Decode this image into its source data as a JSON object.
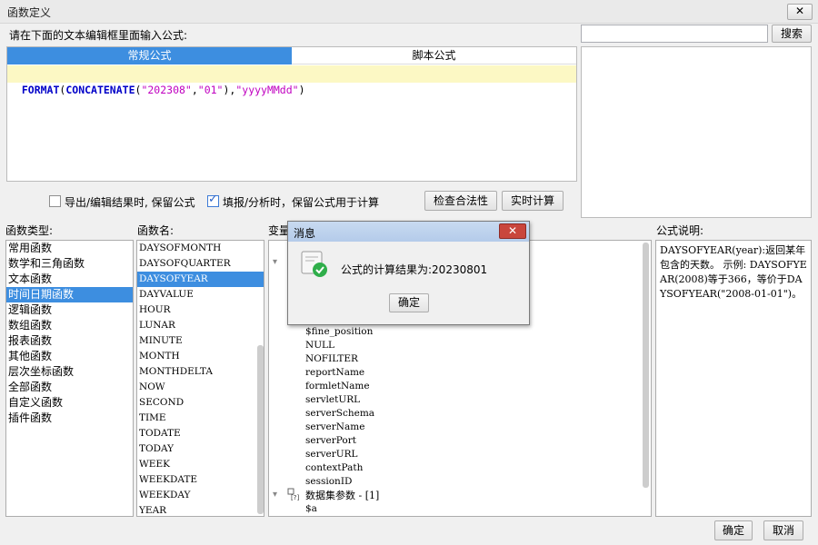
{
  "window": {
    "title": "函数定义",
    "close_glyph": "✕"
  },
  "prompt": "请在下面的文本编辑框里面输入公式:",
  "search": {
    "value": "",
    "button": "搜索"
  },
  "tabs": {
    "normal": "常规公式",
    "script": "脚本公式"
  },
  "formula": {
    "tokens": [
      {
        "text": "FORMAT",
        "kind": "kw"
      },
      {
        "text": "(",
        "kind": "plain"
      },
      {
        "text": "CONCATENATE",
        "kind": "kw"
      },
      {
        "text": "(",
        "kind": "plain"
      },
      {
        "text": "\"202308\"",
        "kind": "str"
      },
      {
        "text": ",",
        "kind": "plain"
      },
      {
        "text": "\"01\"",
        "kind": "str"
      },
      {
        "text": "),",
        "kind": "plain"
      },
      {
        "text": "\"yyyyMMdd\"",
        "kind": "str"
      },
      {
        "text": ")",
        "kind": "plain"
      }
    ]
  },
  "options": {
    "export_keep": {
      "label": "导出/编辑结果时, 保留公式",
      "checked": false
    },
    "fill_keep": {
      "label": "填报/分析时，保留公式用于计算",
      "checked": true
    }
  },
  "buttons": {
    "check": "检查合法性",
    "calc": "实时计算",
    "ok": "确定",
    "cancel": "取消"
  },
  "headers": {
    "category": "函数类型:",
    "function": "函数名:",
    "variable": "变量",
    "description": "公式说明:"
  },
  "categories": [
    "常用函数",
    "数学和三角函数",
    "文本函数",
    "时间日期函数",
    "逻辑函数",
    "数组函数",
    "报表函数",
    "其他函数",
    "层次坐标函数",
    "全部函数",
    "自定义函数",
    "插件函数"
  ],
  "selected_category": "时间日期函数",
  "functions": [
    "DAYSOFMONTH",
    "DAYSOFQUARTER",
    "DAYSOFYEAR",
    "DAYVALUE",
    "HOUR",
    "LUNAR",
    "MINUTE",
    "MONTH",
    "MONTHDELTA",
    "NOW",
    "SECOND",
    "TIME",
    "TODATE",
    "TODAY",
    "WEEK",
    "WEEKDATE",
    "WEEKDAY",
    "YEAR"
  ],
  "selected_function": "DAYSOFYEAR",
  "variables": {
    "items": [
      "$fine_position",
      "NULL",
      "NOFILTER",
      "reportName",
      "formletName",
      "servletURL",
      "serverSchema",
      "serverName",
      "serverPort",
      "serverURL",
      "contextPath",
      "sessionID"
    ],
    "group_label": "数据集参数 - [1]",
    "group_items": [
      "$a"
    ],
    "expand_glyph": "▾"
  },
  "description": "DAYSOFYEAR(year):返回某年包含的天数。 示例: DAYSOFYEAR(2008)等于366，等价于DAYSOFYEAR(\"2008-01-01\")。",
  "message": {
    "title": "消息",
    "text": "公式的计算结果为:20230801",
    "ok": "确定",
    "icon": "success-check-icon",
    "close_glyph": "✕"
  },
  "colors": {
    "accent": "#3d8ee0",
    "formula_bg": "#fcf8c4",
    "keyword": "#0000c8",
    "string": "#c000c0",
    "success": "#2fae4a"
  }
}
